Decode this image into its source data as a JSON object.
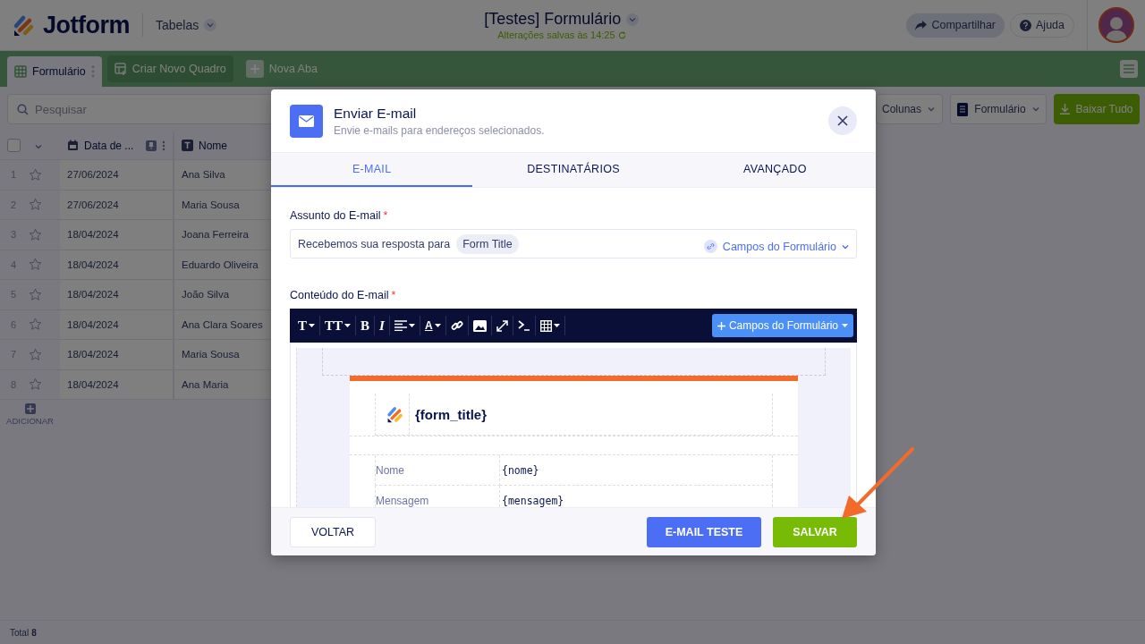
{
  "header": {
    "brand": "Jotform",
    "menu": "Tabelas",
    "title": "[Testes] Formulário",
    "saved_status": "Alterações salvas às 14:25",
    "share_button": "Compartilhar",
    "help_button": "Ajuda"
  },
  "tabs": [
    {
      "label": "Formulário",
      "selected": true,
      "kind": "table"
    },
    {
      "label": "Criar Novo Quadro",
      "selected": false,
      "kind": "board"
    },
    {
      "label": "Nova Aba",
      "selected": false,
      "kind": "add"
    }
  ],
  "toolbar": {
    "search": {
      "placeholder": "Pesquisar"
    },
    "columns_button": "Colunas",
    "form_button": "Formulário",
    "download_button": "Baixar Tudo"
  },
  "table": {
    "select_all": {
      "checked": false
    },
    "columns": [
      {
        "label": "Data de ...",
        "kind": "date"
      },
      {
        "label": "Nome",
        "kind": "text"
      }
    ],
    "rows": [
      {
        "number": "1",
        "starred": false,
        "cells": [
          "27/06/2024",
          "Ana Silva"
        ]
      },
      {
        "number": "2",
        "starred": false,
        "cells": [
          "27/06/2024",
          "Maria Sousa"
        ]
      },
      {
        "number": "3",
        "starred": false,
        "cells": [
          "18/04/2024",
          "Joana Ferreira"
        ]
      },
      {
        "number": "4",
        "starred": false,
        "cells": [
          "18/04/2024",
          "Eduardo Oliveira"
        ]
      },
      {
        "number": "5",
        "starred": false,
        "cells": [
          "18/04/2024",
          "João Silva"
        ]
      },
      {
        "number": "6",
        "starred": false,
        "cells": [
          "18/04/2024",
          "Ana Clara Soares"
        ]
      },
      {
        "number": "7",
        "starred": false,
        "cells": [
          "18/04/2024",
          "Maria Sousa"
        ]
      },
      {
        "number": "8",
        "starred": false,
        "cells": [
          "18/04/2024",
          "Ana Maria"
        ]
      }
    ],
    "add_button": "ADICIONAR"
  },
  "status_bar": {
    "total_label": "Total",
    "total_count": "8"
  },
  "dialog": {
    "title": "Enviar E-mail",
    "subtitle": "Envie e-mails para endereços selecionados.",
    "tabs": [
      {
        "label": "E-MAIL",
        "selected": true
      },
      {
        "label": "DESTINATÁRIOS",
        "selected": false
      },
      {
        "label": "AVANÇADO",
        "selected": false
      }
    ],
    "subject": {
      "label": "Assunto do E-mail",
      "required_mark": "*",
      "text": "Recebemos sua resposta para",
      "tag": "Form Title",
      "fields_menu": "Campos do Formulário"
    },
    "content": {
      "label": "Conteúdo do E-mail",
      "required_mark": "*",
      "editor_tools": [
        {
          "kind": "font",
          "label": "T"
        },
        {
          "kind": "size",
          "label": "TT"
        },
        {
          "kind": "bold",
          "label": "B"
        },
        {
          "kind": "italic",
          "label": "I"
        },
        {
          "kind": "align"
        },
        {
          "kind": "color",
          "label": "A"
        },
        {
          "kind": "link"
        },
        {
          "kind": "image"
        },
        {
          "kind": "expand"
        },
        {
          "kind": "code"
        },
        {
          "kind": "table"
        }
      ],
      "insert_button": "Campos do Formulário",
      "preview": {
        "title": "{form_title}",
        "rows": [
          {
            "label": "Nome",
            "value": "{nome}"
          },
          {
            "label": "Mensagem",
            "value": "{mensagem}"
          }
        ]
      }
    },
    "buttons": {
      "back": "VOLTAR",
      "test": "E-MAIL TESTE",
      "save": "SALVAR"
    }
  }
}
